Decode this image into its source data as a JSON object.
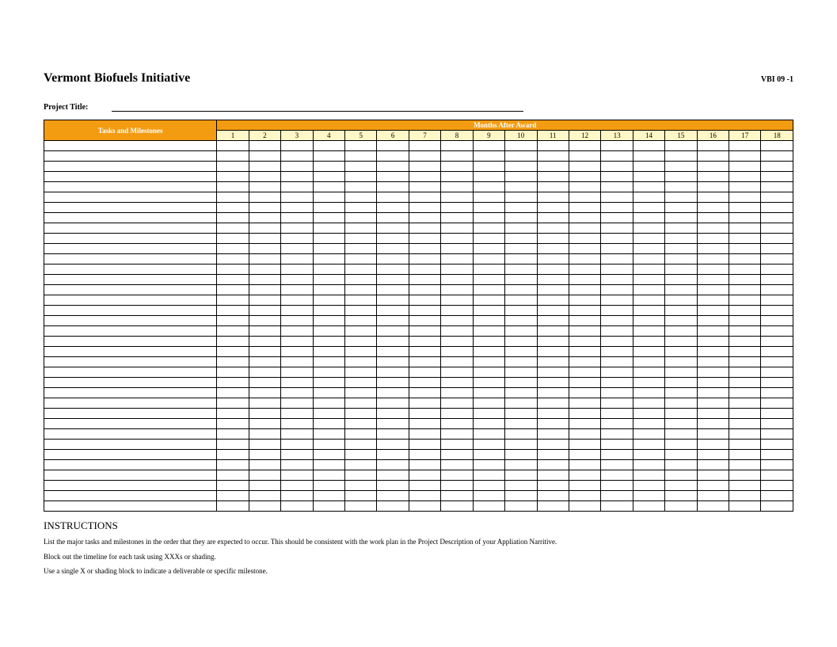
{
  "header": {
    "title": "Vermont Biofuels Initiative",
    "code": "VBI 09 -1"
  },
  "project": {
    "label": "Project Title:",
    "value": ""
  },
  "table": {
    "tasks_header": "Tasks and Milestones",
    "months_header": "Months After Award",
    "months": [
      "1",
      "2",
      "3",
      "4",
      "5",
      "6",
      "7",
      "8",
      "9",
      "10",
      "11",
      "12",
      "13",
      "14",
      "15",
      "16",
      "17",
      "18"
    ],
    "row_count": 36
  },
  "instructions": {
    "title": "INSTRUCTIONS",
    "lines": [
      "List the major tasks and milestones in the order that they are expected to occur. This should be consistent with the work plan in the Project Description of your Appliation Narritive.",
      "Block out the timeline for each task using XXXs or shading.",
      "Use a single X or shading block to indicate a deliverable or specific milestone."
    ]
  }
}
